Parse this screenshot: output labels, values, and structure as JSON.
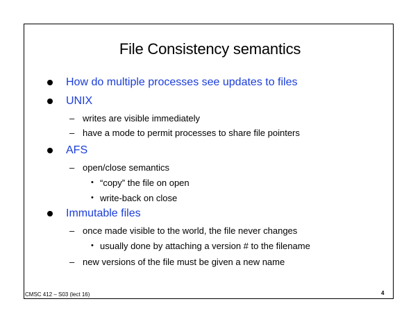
{
  "slide": {
    "title": "File Consistency semantics",
    "bullets": [
      {
        "text": "How do multiple processes see updates to files",
        "subs": []
      },
      {
        "text": "UNIX",
        "subs": [
          {
            "text": "writes are visible immediately",
            "subs": []
          },
          {
            "text": "have a mode to permit processes to share file pointers",
            "subs": []
          }
        ]
      },
      {
        "text": "AFS",
        "subs": [
          {
            "text": "open/close semantics",
            "subs": [
              {
                "text": "“copy” the file on open"
              },
              {
                "text": "write-back on close"
              }
            ]
          }
        ]
      },
      {
        "text": "Immutable files",
        "subs": [
          {
            "text": "once made visible to the world, the file never changes",
            "subs": [
              {
                "text": "usually done by attaching a version # to the filename"
              }
            ]
          },
          {
            "text": "new versions of the file must be given a new name",
            "subs": []
          }
        ]
      }
    ],
    "dash_glyph": "–",
    "dot_glyph": "•",
    "footer": {
      "course": "CMSC 412 – S03  (lect 16)",
      "page_number": "4"
    },
    "colors": {
      "bullet_text": "#1a3dd9",
      "body_text": "#000000",
      "frame": "#000000"
    }
  }
}
